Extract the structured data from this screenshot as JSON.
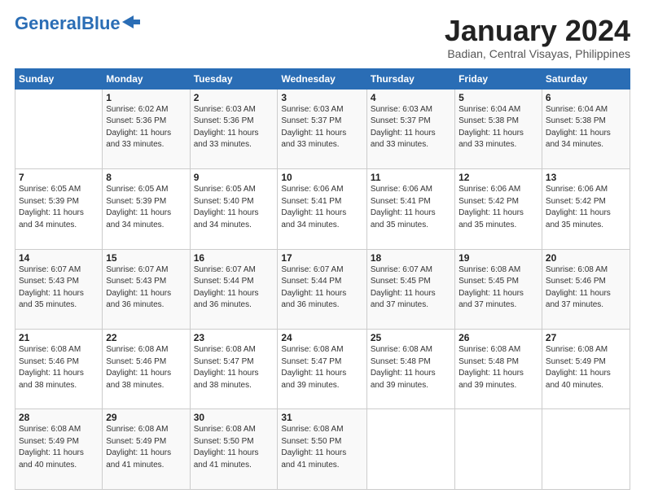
{
  "logo": {
    "part1": "General",
    "part2": "Blue"
  },
  "title": "January 2024",
  "subtitle": "Badian, Central Visayas, Philippines",
  "header_days": [
    "Sunday",
    "Monday",
    "Tuesday",
    "Wednesday",
    "Thursday",
    "Friday",
    "Saturday"
  ],
  "weeks": [
    [
      {
        "num": "",
        "info": ""
      },
      {
        "num": "1",
        "info": "Sunrise: 6:02 AM\nSunset: 5:36 PM\nDaylight: 11 hours\nand 33 minutes."
      },
      {
        "num": "2",
        "info": "Sunrise: 6:03 AM\nSunset: 5:36 PM\nDaylight: 11 hours\nand 33 minutes."
      },
      {
        "num": "3",
        "info": "Sunrise: 6:03 AM\nSunset: 5:37 PM\nDaylight: 11 hours\nand 33 minutes."
      },
      {
        "num": "4",
        "info": "Sunrise: 6:03 AM\nSunset: 5:37 PM\nDaylight: 11 hours\nand 33 minutes."
      },
      {
        "num": "5",
        "info": "Sunrise: 6:04 AM\nSunset: 5:38 PM\nDaylight: 11 hours\nand 33 minutes."
      },
      {
        "num": "6",
        "info": "Sunrise: 6:04 AM\nSunset: 5:38 PM\nDaylight: 11 hours\nand 34 minutes."
      }
    ],
    [
      {
        "num": "7",
        "info": "Sunrise: 6:05 AM\nSunset: 5:39 PM\nDaylight: 11 hours\nand 34 minutes."
      },
      {
        "num": "8",
        "info": "Sunrise: 6:05 AM\nSunset: 5:39 PM\nDaylight: 11 hours\nand 34 minutes."
      },
      {
        "num": "9",
        "info": "Sunrise: 6:05 AM\nSunset: 5:40 PM\nDaylight: 11 hours\nand 34 minutes."
      },
      {
        "num": "10",
        "info": "Sunrise: 6:06 AM\nSunset: 5:41 PM\nDaylight: 11 hours\nand 34 minutes."
      },
      {
        "num": "11",
        "info": "Sunrise: 6:06 AM\nSunset: 5:41 PM\nDaylight: 11 hours\nand 35 minutes."
      },
      {
        "num": "12",
        "info": "Sunrise: 6:06 AM\nSunset: 5:42 PM\nDaylight: 11 hours\nand 35 minutes."
      },
      {
        "num": "13",
        "info": "Sunrise: 6:06 AM\nSunset: 5:42 PM\nDaylight: 11 hours\nand 35 minutes."
      }
    ],
    [
      {
        "num": "14",
        "info": "Sunrise: 6:07 AM\nSunset: 5:43 PM\nDaylight: 11 hours\nand 35 minutes."
      },
      {
        "num": "15",
        "info": "Sunrise: 6:07 AM\nSunset: 5:43 PM\nDaylight: 11 hours\nand 36 minutes."
      },
      {
        "num": "16",
        "info": "Sunrise: 6:07 AM\nSunset: 5:44 PM\nDaylight: 11 hours\nand 36 minutes."
      },
      {
        "num": "17",
        "info": "Sunrise: 6:07 AM\nSunset: 5:44 PM\nDaylight: 11 hours\nand 36 minutes."
      },
      {
        "num": "18",
        "info": "Sunrise: 6:07 AM\nSunset: 5:45 PM\nDaylight: 11 hours\nand 37 minutes."
      },
      {
        "num": "19",
        "info": "Sunrise: 6:08 AM\nSunset: 5:45 PM\nDaylight: 11 hours\nand 37 minutes."
      },
      {
        "num": "20",
        "info": "Sunrise: 6:08 AM\nSunset: 5:46 PM\nDaylight: 11 hours\nand 37 minutes."
      }
    ],
    [
      {
        "num": "21",
        "info": "Sunrise: 6:08 AM\nSunset: 5:46 PM\nDaylight: 11 hours\nand 38 minutes."
      },
      {
        "num": "22",
        "info": "Sunrise: 6:08 AM\nSunset: 5:46 PM\nDaylight: 11 hours\nand 38 minutes."
      },
      {
        "num": "23",
        "info": "Sunrise: 6:08 AM\nSunset: 5:47 PM\nDaylight: 11 hours\nand 38 minutes."
      },
      {
        "num": "24",
        "info": "Sunrise: 6:08 AM\nSunset: 5:47 PM\nDaylight: 11 hours\nand 39 minutes."
      },
      {
        "num": "25",
        "info": "Sunrise: 6:08 AM\nSunset: 5:48 PM\nDaylight: 11 hours\nand 39 minutes."
      },
      {
        "num": "26",
        "info": "Sunrise: 6:08 AM\nSunset: 5:48 PM\nDaylight: 11 hours\nand 39 minutes."
      },
      {
        "num": "27",
        "info": "Sunrise: 6:08 AM\nSunset: 5:49 PM\nDaylight: 11 hours\nand 40 minutes."
      }
    ],
    [
      {
        "num": "28",
        "info": "Sunrise: 6:08 AM\nSunset: 5:49 PM\nDaylight: 11 hours\nand 40 minutes."
      },
      {
        "num": "29",
        "info": "Sunrise: 6:08 AM\nSunset: 5:49 PM\nDaylight: 11 hours\nand 41 minutes."
      },
      {
        "num": "30",
        "info": "Sunrise: 6:08 AM\nSunset: 5:50 PM\nDaylight: 11 hours\nand 41 minutes."
      },
      {
        "num": "31",
        "info": "Sunrise: 6:08 AM\nSunset: 5:50 PM\nDaylight: 11 hours\nand 41 minutes."
      },
      {
        "num": "",
        "info": ""
      },
      {
        "num": "",
        "info": ""
      },
      {
        "num": "",
        "info": ""
      }
    ]
  ]
}
